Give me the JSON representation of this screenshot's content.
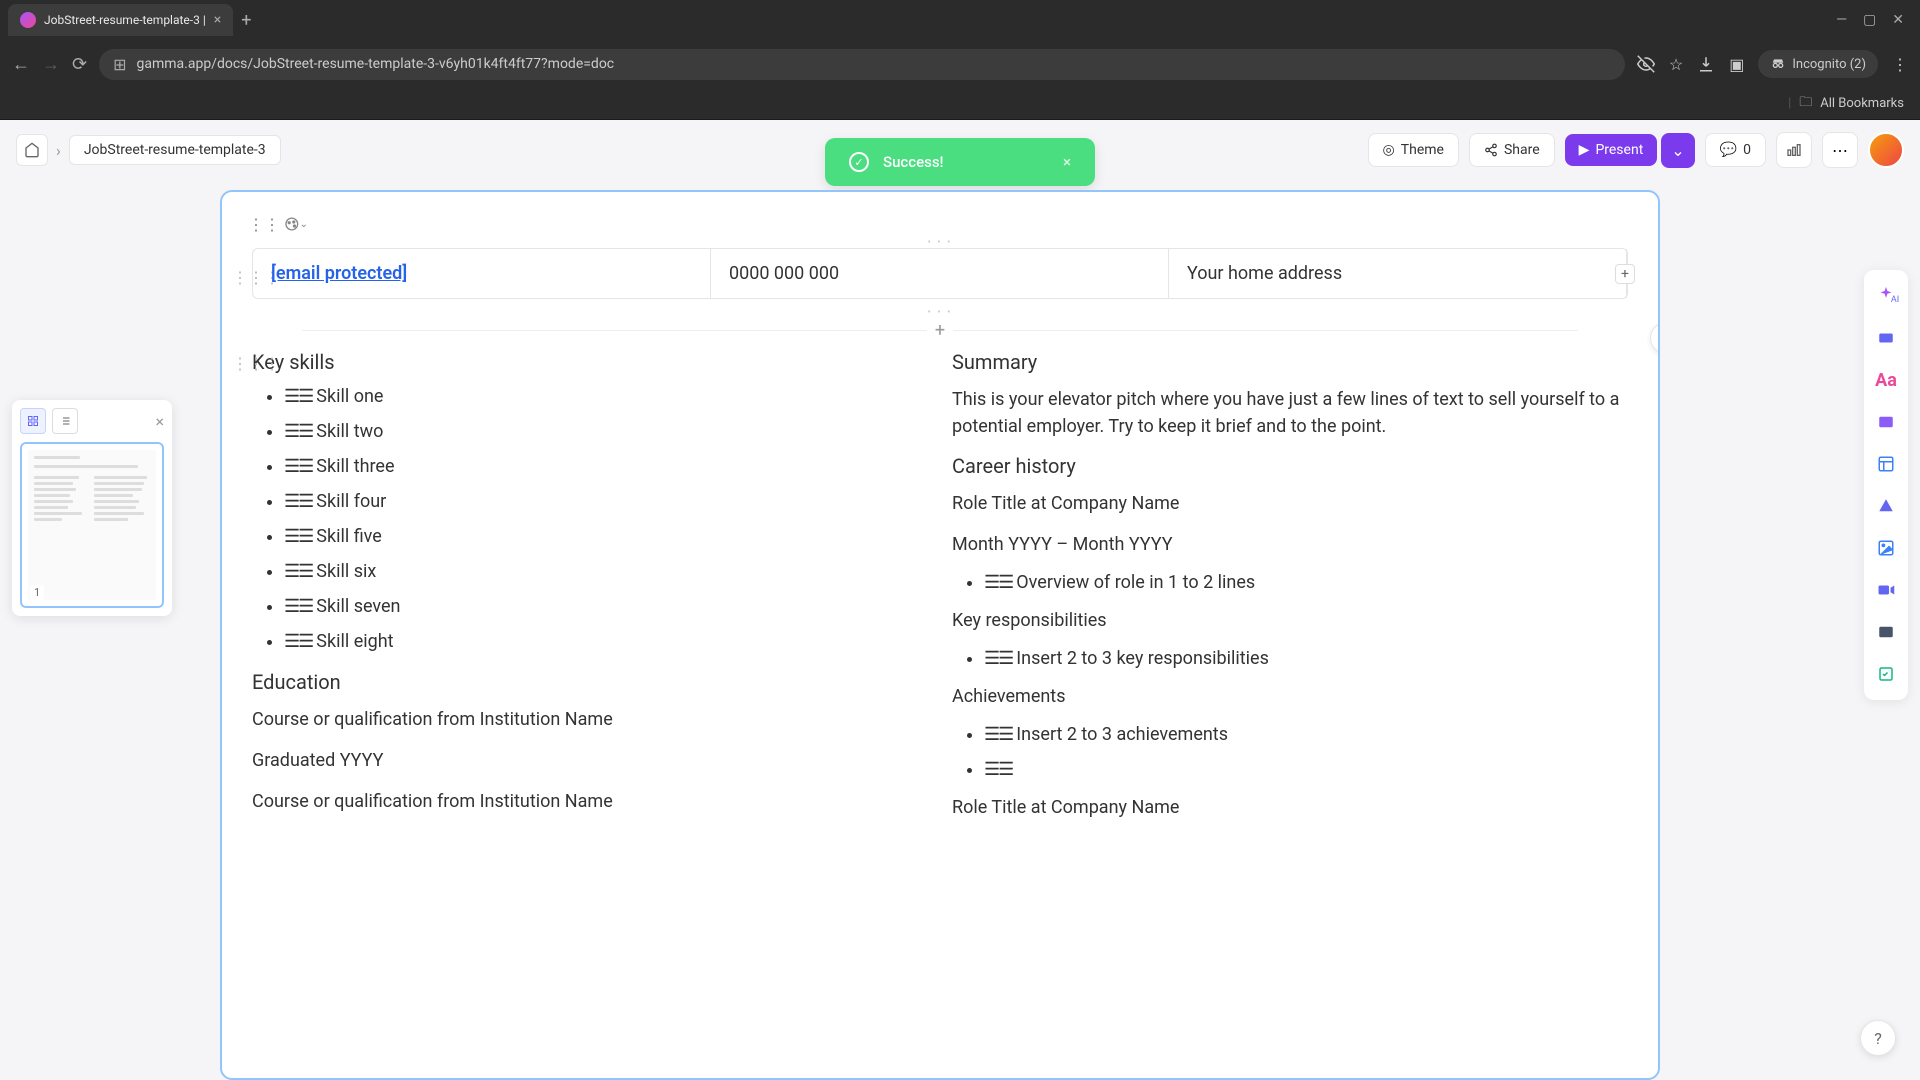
{
  "browser": {
    "tab_title": "JobStreet-resume-template-3 |",
    "url": "gamma.app/docs/JobStreet-resume-template-3-v6yh01k4ft4ft77?mode=doc",
    "incognito_label": "Incognito (2)",
    "all_bookmarks": "All Bookmarks"
  },
  "header": {
    "doc_title": "JobStreet-resume-template-3",
    "theme": "Theme",
    "share": "Share",
    "present": "Present",
    "comments_count": "0"
  },
  "toast": {
    "message": "Success!"
  },
  "contact": {
    "email": "[email protected]",
    "phone": "0000 000 000",
    "address": "Your home address"
  },
  "skills": {
    "title": "Key skills",
    "items": [
      "Skill one",
      "Skill two",
      "Skill three",
      "Skill four",
      "Skill five",
      "Skill six",
      "Skill seven",
      "Skill eight"
    ]
  },
  "education": {
    "title": "Education",
    "course1": "Course or qualification from Institution Name",
    "grad1": "Graduated YYYY",
    "course2": "Course or qualification from Institution Name"
  },
  "summary": {
    "title": "Summary",
    "body": "This is your elevator pitch where you have just a few lines of text to sell yourself to a potential employer. Try to keep it brief and to the point."
  },
  "career": {
    "title": "Career history",
    "role1_title": "Role Title at Company Name",
    "role1_dates": "Month YYYY – Month YYYY",
    "role1_overview": "Overview of role in 1 to 2 lines",
    "responsibilities_title": "Key responsibilities",
    "responsibilities_item": "Insert 2 to 3 key responsibilities",
    "achievements_title": "Achievements",
    "achievements_item": "Insert 2 to 3 achievements",
    "role2_title": "Role Title at Company Name"
  },
  "thumbnail": {
    "page_num": "1"
  }
}
